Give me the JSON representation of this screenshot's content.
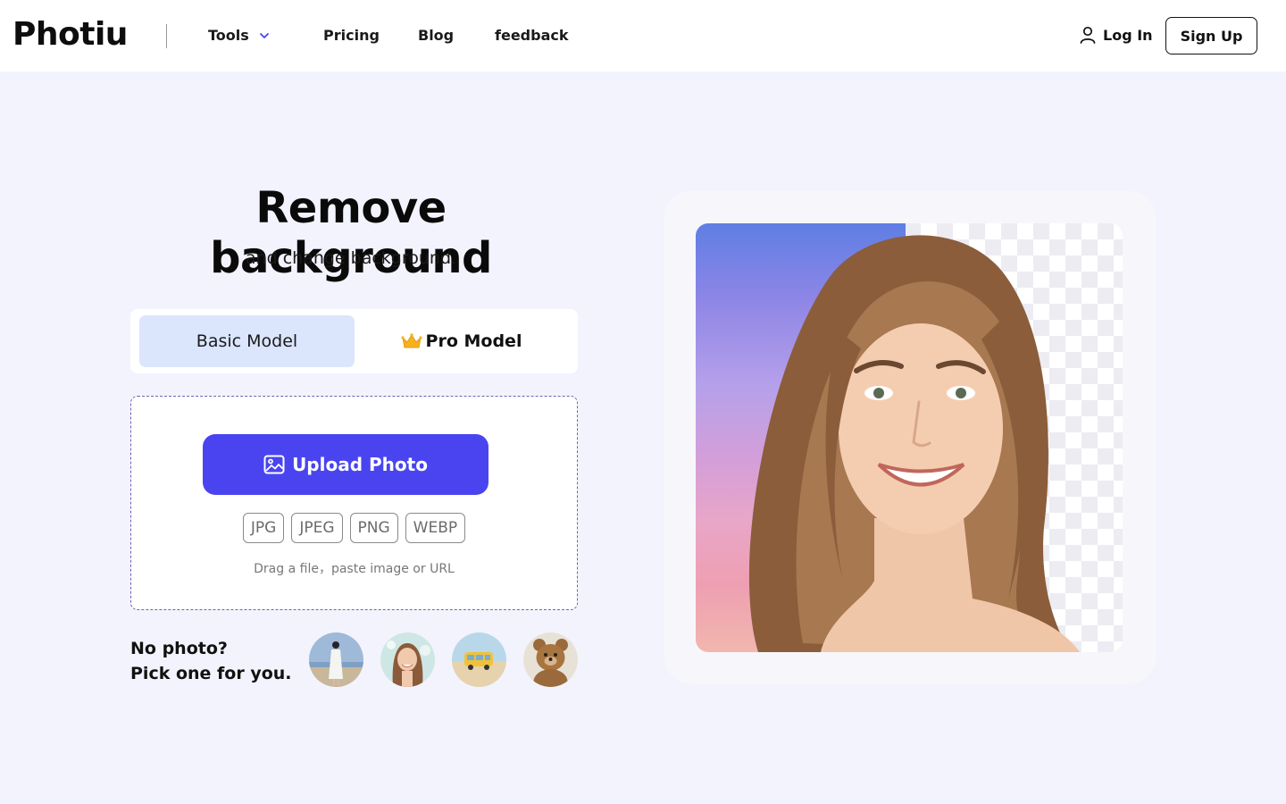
{
  "header": {
    "logo": "Photiu",
    "nav": {
      "tools": "Tools",
      "pricing": "Pricing",
      "blog": "Blog",
      "feedback": "feedback"
    },
    "login": "Log In",
    "signup": "Sign Up"
  },
  "hero": {
    "title": "Remove background",
    "subtitle": "and change background."
  },
  "models": {
    "basic": "Basic Model",
    "pro": "Pro Model",
    "selected": "Basic Model"
  },
  "upload": {
    "button": "Upload Photo",
    "formats": [
      "JPG",
      "JPEG",
      "PNG",
      "WEBP"
    ],
    "hint": "Drag a file，paste image or URL"
  },
  "samples": {
    "label_line1": "No photo?",
    "label_line2": "Pick one for you.",
    "items": [
      "woman-in-white-dress-beach",
      "smiling-woman-portrait",
      "yellow-van-beach",
      "teddy-bear"
    ]
  },
  "colors": {
    "accent": "#4a44f0",
    "background": "#f3f3fd",
    "selected_model": "#dbe6fc"
  }
}
